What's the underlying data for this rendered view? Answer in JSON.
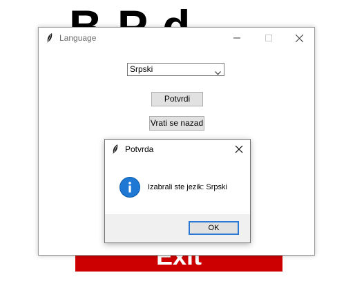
{
  "background": {
    "title_text": "B  P    d",
    "exit_label": "Exit"
  },
  "window": {
    "title": "Language",
    "icon": "feather-icon",
    "controls": [
      "minimize-icon",
      "maximize-icon",
      "close-icon"
    ],
    "language_select": {
      "selected": "Srpski",
      "icon": "chevron-down-icon"
    },
    "confirm_label": "Potvrdi",
    "back_label": "Vrati se nazad"
  },
  "dialog": {
    "title": "Potvrda",
    "message": "Izabrali ste jezik: Srpski",
    "icon": "info-icon",
    "ok_label": "OK"
  },
  "colors": {
    "exit_red": "#cc0000",
    "ok_focus": "#2a77d4",
    "info_blue": "#1e78d4"
  }
}
